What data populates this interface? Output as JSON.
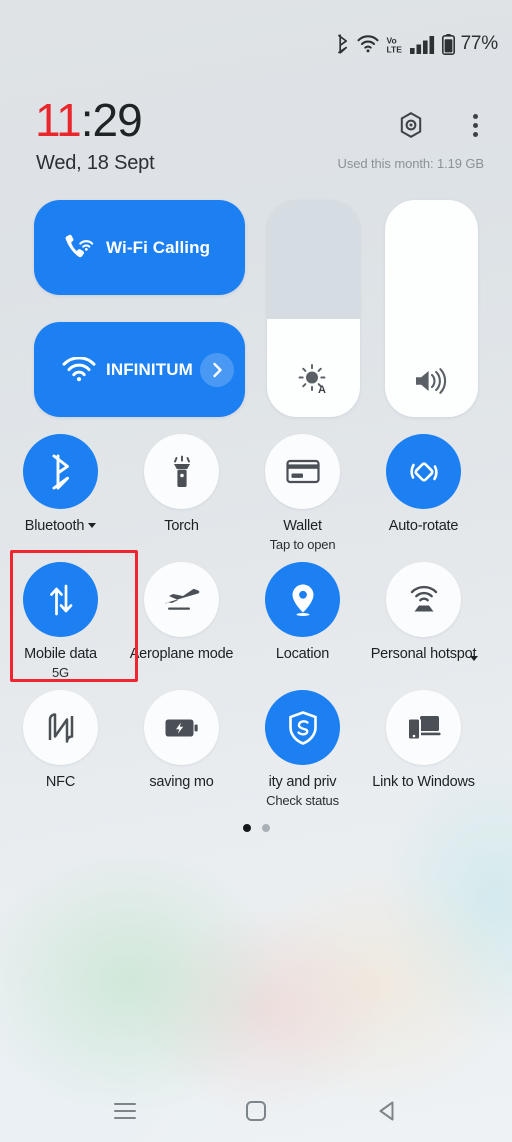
{
  "status_bar": {
    "icons": [
      "bluetooth-icon",
      "wifi-icon",
      "volte-icon",
      "signal-bars-icon",
      "battery-icon"
    ],
    "battery_percent": "77%"
  },
  "header": {
    "time_hours": "11",
    "time_minutes": ":29",
    "date": "Wed, 18 Sept",
    "data_usage": "Used this month: 1.19 GB",
    "settings_icon": "gear-icon",
    "overflow_icon": "kebab-menu-icon"
  },
  "quick_panel": {
    "pills": [
      {
        "label": "Wi-Fi Calling",
        "icon": "phone-wifi-icon",
        "active": true,
        "has_chevron": false
      },
      {
        "label": "INFINITUM",
        "icon": "wifi-icon",
        "active": true,
        "has_chevron": true,
        "chevron_icon": "chevron-right-icon"
      }
    ],
    "sliders": [
      {
        "name": "brightness",
        "icon": "brightness-auto-icon",
        "level_percent": 45
      },
      {
        "name": "volume",
        "icon": "volume-up-icon",
        "level_percent": 100
      }
    ],
    "tiles": [
      {
        "label": "Bluetooth",
        "sub": "",
        "icon": "bluetooth-icon",
        "active": true,
        "caret": "inline"
      },
      {
        "label": "Torch",
        "sub": "",
        "icon": "flashlight-icon",
        "active": false,
        "caret": "none"
      },
      {
        "label": "Wallet",
        "sub": "Tap to open",
        "icon": "credit-card-icon",
        "active": false,
        "caret": "none"
      },
      {
        "label": "Auto-rotate",
        "sub": "",
        "icon": "auto-rotate-icon",
        "active": true,
        "caret": "none"
      },
      {
        "label": "Mobile data",
        "sub": "5G",
        "icon": "data-transfer-icon",
        "active": true,
        "caret": "none"
      },
      {
        "label": "Aeroplane mode",
        "sub": "",
        "icon": "airplane-icon",
        "active": false,
        "caret": "none"
      },
      {
        "label": "Location",
        "sub": "",
        "icon": "location-pin-icon",
        "active": true,
        "caret": "none"
      },
      {
        "label": "Personal hotspot",
        "sub": "",
        "icon": "hotspot-icon",
        "active": false,
        "caret": "corner"
      },
      {
        "label": "NFC",
        "sub": "",
        "icon": "nfc-icon",
        "active": false,
        "caret": "none"
      },
      {
        "label": "saving mo",
        "sub": "",
        "icon": "battery-saver-icon",
        "active": false,
        "caret": "none",
        "clipped": true
      },
      {
        "label": "ity and priv",
        "sub": "Check status",
        "icon": "shield-icon",
        "active": true,
        "caret": "none",
        "clipped": true
      },
      {
        "label": "Link to Windows",
        "sub": "",
        "icon": "link-to-windows-icon",
        "active": false,
        "caret": "none"
      }
    ],
    "pager": {
      "count": 2,
      "active_index": 0
    }
  },
  "annotation": {
    "target": "Mobile data",
    "color": "#f0252e"
  },
  "nav_bar": {
    "recents_icon": "recents-icon",
    "home_icon": "home-icon",
    "back_icon": "back-icon"
  },
  "colors": {
    "accent_blue": "#1c7ff2",
    "clock_red": "#e8262b",
    "annotation_red": "#f0252e",
    "tile_off": "#fbfcfd"
  }
}
